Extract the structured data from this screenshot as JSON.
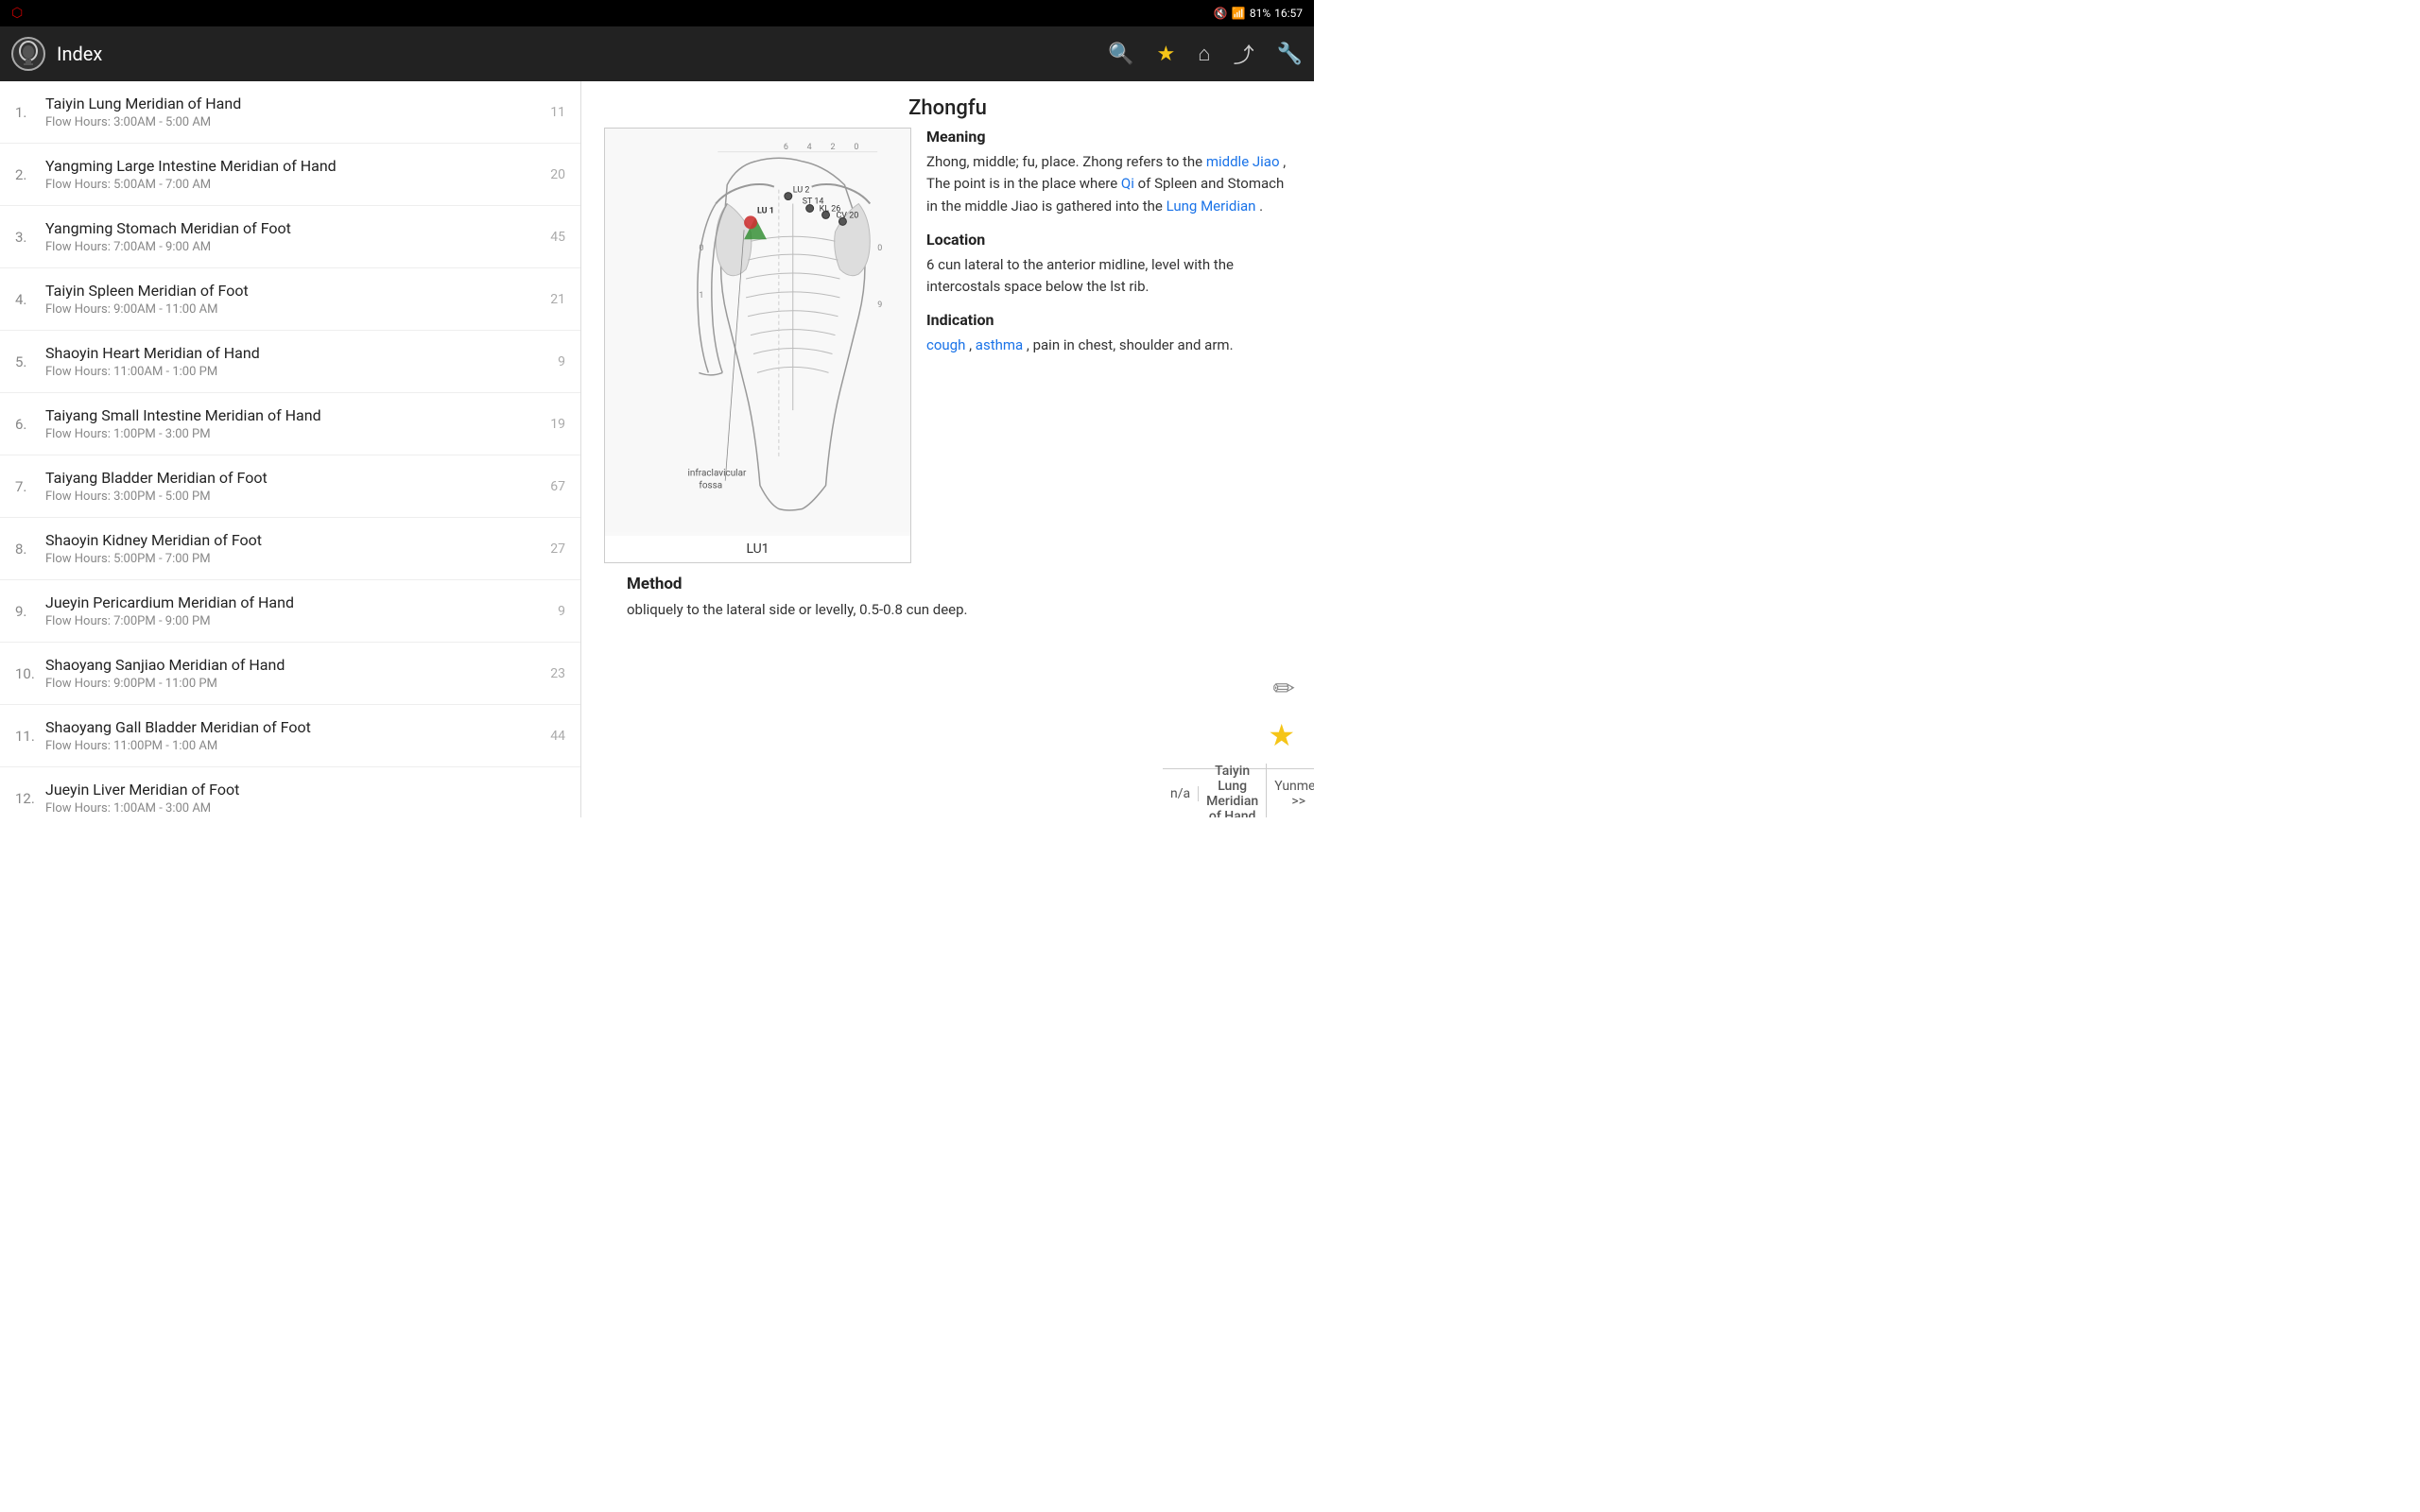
{
  "statusBar": {
    "time": "16:57",
    "battery": "81%"
  },
  "topBar": {
    "title": "Index",
    "actions": [
      "search",
      "star",
      "home",
      "share",
      "settings"
    ]
  },
  "list": {
    "items": [
      {
        "num": "1.",
        "title": "Taiyin Lung Meridian of Hand",
        "sub": "Flow Hours: 3:00AM - 5:00 AM",
        "count": "11"
      },
      {
        "num": "2.",
        "title": "Yangming Large Intestine Meridian of Hand",
        "sub": "Flow Hours: 5:00AM - 7:00 AM",
        "count": "20"
      },
      {
        "num": "3.",
        "title": "Yangming Stomach Meridian of Foot",
        "sub": "Flow Hours: 7:00AM - 9:00 AM",
        "count": "45"
      },
      {
        "num": "4.",
        "title": "Taiyin Spleen Meridian of Foot",
        "sub": "Flow Hours: 9:00AM - 11:00 AM",
        "count": "21"
      },
      {
        "num": "5.",
        "title": "Shaoyin Heart Meridian of Hand",
        "sub": "Flow Hours: 11:00AM - 1:00 PM",
        "count": "9"
      },
      {
        "num": "6.",
        "title": "Taiyang Small Intestine Meridian of Hand",
        "sub": "Flow Hours: 1:00PM - 3:00 PM",
        "count": "19"
      },
      {
        "num": "7.",
        "title": "Taiyang Bladder Meridian of Foot",
        "sub": "Flow Hours: 3:00PM - 5:00 PM",
        "count": "67"
      },
      {
        "num": "8.",
        "title": "Shaoyin Kidney Meridian of Foot",
        "sub": "Flow Hours: 5:00PM - 7:00 PM",
        "count": "27"
      },
      {
        "num": "9.",
        "title": "Jueyin Pericardium Meridian of Hand",
        "sub": "Flow Hours: 7:00PM - 9:00 PM",
        "count": "9"
      },
      {
        "num": "10.",
        "title": "Shaoyang Sanjiao Meridian of Hand",
        "sub": "Flow Hours: 9:00PM - 11:00 PM",
        "count": "23"
      },
      {
        "num": "11.",
        "title": "Shaoyang Gall Bladder Meridian of Foot",
        "sub": "Flow Hours: 11:00PM - 1:00 AM",
        "count": "44"
      },
      {
        "num": "12.",
        "title": "Jueyin Liver Meridian of Foot",
        "sub": "Flow Hours: 1:00AM - 3:00 AM",
        "count": ""
      }
    ]
  },
  "detail": {
    "title": "Zhongfu",
    "imageLabel": "LU1",
    "meaning": {
      "sectionTitle": "Meaning",
      "body": "Zhong, middle; fu, place. Zhong refers to the",
      "link1": "middle Jiao",
      "body2": ", The point is in the place where",
      "link2": "Qi",
      "body3": "of Spleen and Stomach in the middle Jiao is gathered into the",
      "link3": "Lung Meridian",
      "body4": "."
    },
    "location": {
      "sectionTitle": "Location",
      "body": "6 cun lateral to the anterior midline, level with the intercostals space below the lst rib."
    },
    "indication": {
      "sectionTitle": "Indication",
      "link1": "cough",
      "link2": "asthma",
      "body": ", pain in chest, shoulder and arm."
    },
    "method": {
      "sectionTitle": "Method",
      "body": "obliquely to the lateral side or levelly, 0.5-0.8 cun deep."
    }
  },
  "bottomNav": {
    "prev": "n/a",
    "center": "Taiyin Lung Meridian of Hand",
    "next": "Yunmen >>"
  }
}
